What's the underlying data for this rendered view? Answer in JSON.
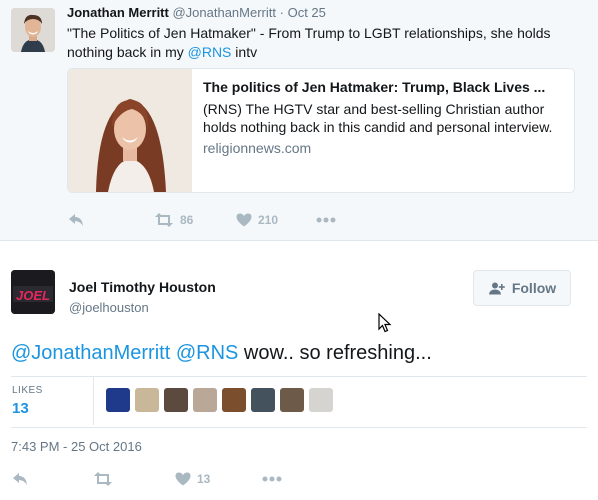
{
  "quoted_tweet": {
    "author_name": "Jonathan Merritt",
    "author_handle": "@JonathanMerritt",
    "separator": "·",
    "date": "Oct 25",
    "text_before": "\"The Politics of Jen Hatmaker\" - From Trump to LGBT relationships, she holds nothing back in my ",
    "mention": "@RNS",
    "text_after": " intv",
    "card": {
      "title": "The politics of Jen Hatmaker: Trump, Black Lives ...",
      "description": "(RNS) The HGTV star and best-selling Christian author holds nothing back in this candid and personal interview.",
      "domain": "religionnews.com"
    },
    "actions": {
      "reply_icon": "reply-icon",
      "retweet_icon": "retweet-icon",
      "retweet_count": "86",
      "like_icon": "heart-icon",
      "like_count": "210",
      "more_icon": "more-icon"
    }
  },
  "main_tweet": {
    "author_name": "Joel Timothy Houston",
    "author_handle": "@joelhouston",
    "avatar_text": "JOEL",
    "follow_label": "Follow",
    "mention1": "@JonathanMerritt",
    "mention2": "@RNS",
    "text": " wow.. so refreshing...",
    "likes_label": "LIKES",
    "likes_count": "13",
    "timestamp": "7:43 PM - 25 Oct 2016",
    "actions": {
      "reply_icon": "reply-icon",
      "retweet_icon": "retweet-icon",
      "like_icon": "heart-icon",
      "like_count": "13",
      "more_icon": "more-icon"
    }
  },
  "colors": {
    "link": "#1b95e0",
    "muted": "#657786",
    "icon": "#aab8c2",
    "top_background": "#f5f8fa",
    "border": "#e1e8ed"
  }
}
